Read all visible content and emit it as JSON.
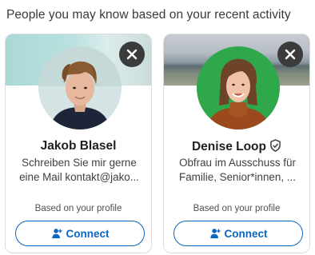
{
  "section": {
    "title": "People you may know based on your recent activity"
  },
  "cards": [
    {
      "name": "Jakob Blasel",
      "headline_line1": "Schreiben Sie mir gerne",
      "headline_line2": "eine Mail kontakt@jako...",
      "verified": false,
      "reason": "Based on your profile",
      "connect_label": "Connect"
    },
    {
      "name": "Denise Loop",
      "headline_line1": "Obfrau im Ausschuss für",
      "headline_line2": "Familie, Senior*innen, ...",
      "verified": true,
      "reason": "Based on your profile",
      "connect_label": "Connect"
    }
  ],
  "colors": {
    "accent": "#0a66c2",
    "dismiss_bg": "#3b3b3b",
    "card_border": "#dcdcdc"
  },
  "icons": {
    "dismiss": "close-icon",
    "connect": "add-person-icon",
    "verified": "verified-shield-icon"
  }
}
